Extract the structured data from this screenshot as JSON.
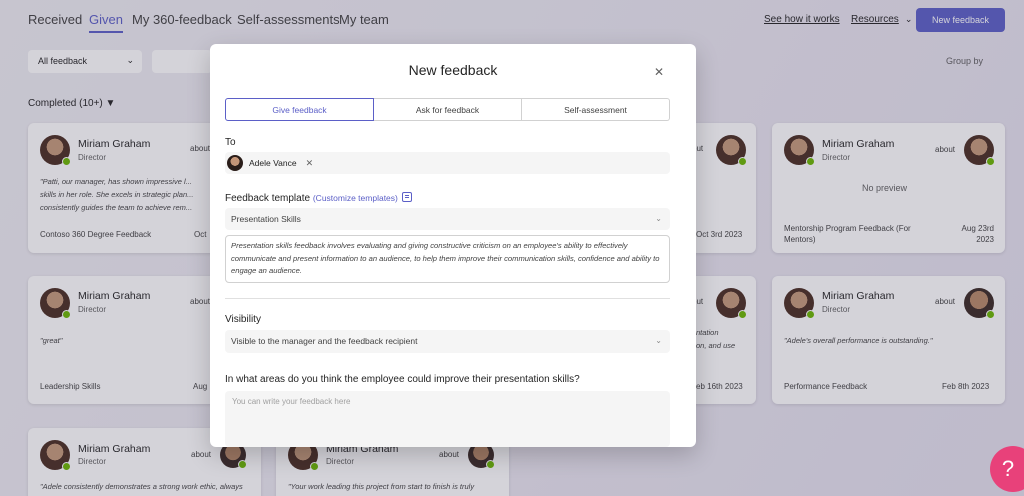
{
  "nav": {
    "tabs": [
      "Received",
      "Given",
      "My 360-feedback",
      "Self-assessments",
      "My team"
    ],
    "active_tab": "Given",
    "see_how": "See how it works",
    "resources": "Resources",
    "new_feedback": "New feedback"
  },
  "toolbar": {
    "filter": "All feedback",
    "group_by": "Group by",
    "completed": "Completed (10+)"
  },
  "cards": [
    {
      "name": "Miriam Graham",
      "role": "Director",
      "about": "about",
      "text": "\"Patti, our manager, has shown impressive l... skills in her role. She excels in strategic plan... consistently guides the team to achieve rem...",
      "footer": "Contoso 360 Degree Feedback",
      "date": "Oct"
    },
    {
      "name": "Miriam Graham",
      "role": "Director",
      "about": "about",
      "text": "\"great\"",
      "footer": "Leadership Skills",
      "date": "Aug"
    },
    {
      "name": "Miriam Graham",
      "role": "Director",
      "about": "about",
      "text": "\"Adele consistently demonstrates a strong work ethic, always striving to achieve high-quality results",
      "footer": "",
      "date": ""
    },
    {
      "name": "Miriam Graham",
      "role": "Director",
      "about": "about",
      "text": "\"Your work leading this project from start to finish is truly exemplary. In fact, I want to use it as a good",
      "footer": "",
      "date": ""
    },
    {
      "name": "Miriam Graham",
      "role": "Director",
      "about": "about",
      "text": "No preview",
      "footer": "Mentorship Program Feedback (For Mentors)",
      "date": "Aug 23rd 2023"
    },
    {
      "name": "Miriam Graham",
      "role": "Director",
      "about": "about",
      "text": "\"Adele's overall performance is outstanding.\"",
      "footer": "Performance Feedback",
      "date": "Feb 8th 2023"
    }
  ],
  "partial": {
    "r1_about": "out",
    "r1_date": "Oct 3rd 2023",
    "r2_about": "out",
    "r2_l1": "ntation",
    "r2_l2": "on, and use",
    "r2_date": "eb 16th 2023"
  },
  "modal": {
    "title": "New feedback",
    "segments": [
      "Give feedback",
      "Ask for feedback",
      "Self-assessment"
    ],
    "active_segment": "Give feedback",
    "to_label": "To",
    "recipient": "Adele Vance",
    "template_label": "Feedback template",
    "customize_link": "(Customize templates)",
    "template_value": "Presentation Skills",
    "template_description": "Presentation skills feedback involves evaluating and giving constructive criticism on an employee's ability to effectively communicate and present information to an audience, to help them improve their communication skills, confidence and ability to engage an audience.",
    "visibility_label": "Visibility",
    "visibility_value": "Visible to the manager and the feedback recipient",
    "question": "In what areas do you think the employee could improve their presentation skills?",
    "answer_placeholder": "You can write your feedback here"
  },
  "help_label": "?",
  "colors": {
    "accent": "#5b5fc7",
    "presence": "#6bb700",
    "help": "#e8417a"
  }
}
